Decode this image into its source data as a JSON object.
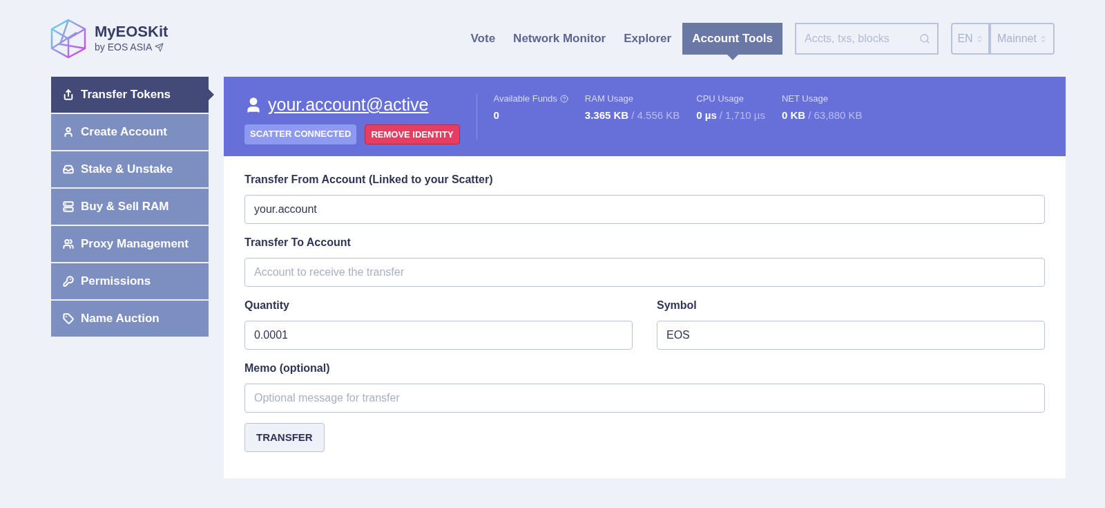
{
  "brand": {
    "name": "MyEOSKit",
    "byline": "by EOS ASIA"
  },
  "nav": [
    {
      "label": "Vote",
      "selected": false
    },
    {
      "label": "Network Monitor",
      "selected": false
    },
    {
      "label": "Explorer",
      "selected": false
    },
    {
      "label": "Account Tools",
      "selected": true
    }
  ],
  "search": {
    "placeholder": "Accts, txs, blocks"
  },
  "language": "EN",
  "network": "Mainnet",
  "sidebar": {
    "items": [
      {
        "label": "Transfer Tokens",
        "kind": "transfer",
        "selected": true
      },
      {
        "label": "Create Account",
        "kind": "user",
        "selected": false
      },
      {
        "label": "Stake & Unstake",
        "kind": "stake",
        "selected": false
      },
      {
        "label": "Buy & Sell RAM",
        "kind": "ram",
        "selected": false
      },
      {
        "label": "Proxy Management",
        "kind": "users",
        "selected": false
      },
      {
        "label": "Permissions",
        "kind": "key",
        "selected": false
      },
      {
        "label": "Name Auction",
        "kind": "tag",
        "selected": false
      }
    ]
  },
  "account": {
    "name": "your.account@active",
    "badges": [
      {
        "label": "SCATTER CONNECTED",
        "kind": "status"
      },
      {
        "label": "REMOVE IDENTITY",
        "kind": "danger"
      }
    ],
    "stats": [
      {
        "label": "Available Funds",
        "help": true,
        "value": "0"
      },
      {
        "label": "RAM Usage",
        "help": false,
        "value": "3.365 KB",
        "total": "/ 4.556 KB"
      },
      {
        "label": "CPU Usage",
        "help": false,
        "value": "0 µs",
        "total": "/ 1,710 µs"
      },
      {
        "label": "NET Usage",
        "help": false,
        "value": "0 KB",
        "total": "/ 63,880 KB"
      }
    ]
  },
  "form": {
    "fields": [
      {
        "label": "Transfer From Account (Linked to your Scatter)",
        "value": "your.account",
        "kind": "full"
      },
      {
        "label": "Transfer To Account",
        "placeholder": "Account to receive the transfer",
        "kind": "full"
      },
      {
        "label": "Quantity",
        "value": "0.0001",
        "kind": "half"
      },
      {
        "label": "Symbol",
        "value": "EOS",
        "kind": "half"
      },
      {
        "label": "Memo (optional)",
        "placeholder": "Optional message for transfer",
        "kind": "full"
      }
    ],
    "submit": "TRANSFER"
  }
}
